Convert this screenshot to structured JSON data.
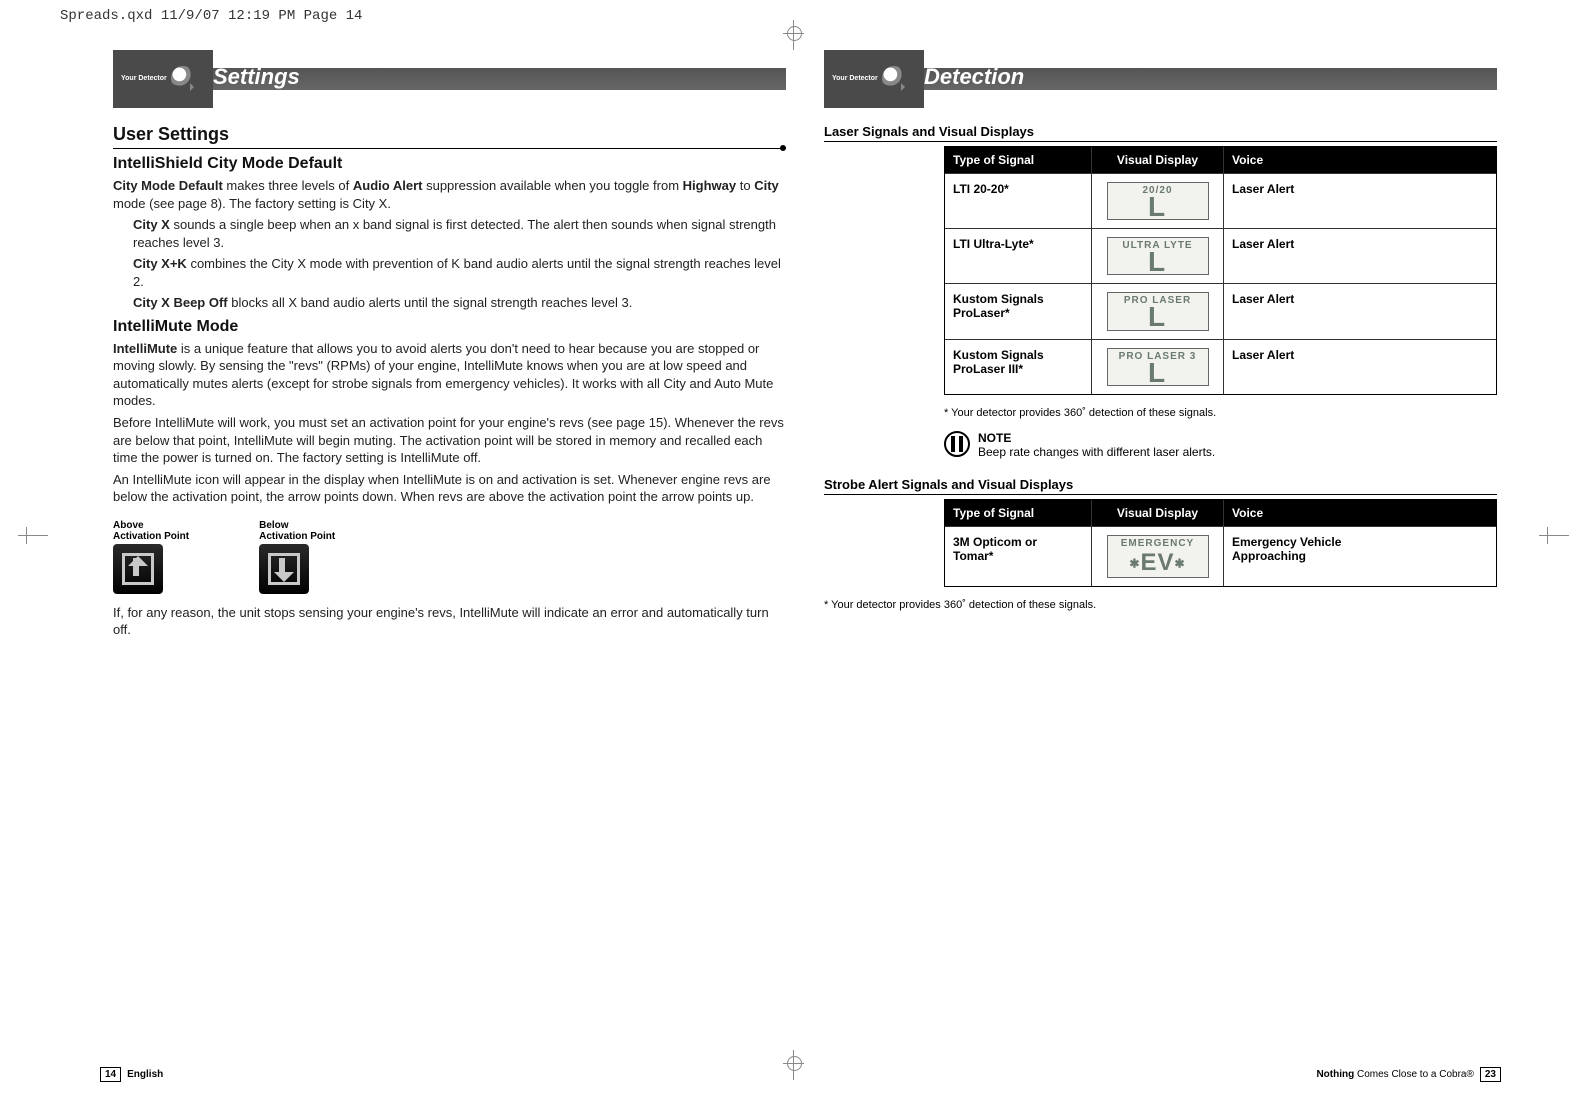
{
  "meta": {
    "imposition": "Spreads.qxd  11/9/07  12:19 PM  Page 14"
  },
  "left": {
    "banner": {
      "tag": "Your Detector",
      "title": "Settings"
    },
    "h2": "User Settings",
    "intellishield": {
      "title": "IntelliShield City Mode Default",
      "lead": "City Mode Default",
      "p1a": "makes three levels of",
      "bold1": "Audio Alert",
      "p1b": "suppression available when you toggle from",
      "bold2": "Highway",
      "p1c": "to",
      "bold3": "City",
      "p1d": "mode (see page 8). The factory setting is City X."
    },
    "modes": [
      {
        "name": "City X",
        "desc": "sounds a single beep when an x band signal is first detected. The alert then sounds when signal strength reaches level 3."
      },
      {
        "name": "City X+K",
        "desc": "combines the City X mode with prevention of K band audio alerts until the signal strength reaches level 2."
      },
      {
        "name": "City X Beep Off",
        "desc": "blocks all X band audio alerts until the signal strength reaches level 3."
      }
    ],
    "intellimute": {
      "title": "IntelliMute Mode",
      "lead": "IntelliMute",
      "p1": "is a unique feature that allows you to avoid alerts you don't need to hear because you are stopped or moving slowly. By sensing the \"revs\" (RPMs) of your engine, IntelliMute knows when you are at low speed and automatically mutes alerts (except for strobe signals from emergency vehicles). It works with all City and Auto Mute modes.",
      "p2": "Before IntelliMute will work, you must set an activation point for your engine's revs (see page 15). Whenever the revs are below that point, IntelliMute will begin muting. The activation point will be stored in memory and recalled each time the power is turned on. The factory setting is IntelliMute off.",
      "p3": "An IntelliMute icon will appear in the display when IntelliMute is on and activation is set. Whenever engine revs are below the activation point, the arrow points down. When revs are above the activation point the arrow points up.",
      "p4": "If, for any reason, the unit stops sensing your engine's revs, IntelliMute will indicate an error and automatically turn off."
    },
    "ap": {
      "above": {
        "l1": "Above",
        "l2": "Activation Point"
      },
      "below": {
        "l1": "Below",
        "l2": "Activation Point"
      }
    },
    "footer": {
      "page": "14",
      "lang": "English"
    }
  },
  "right": {
    "banner": {
      "tag": "Your Detector",
      "title": "Detection"
    },
    "headers": [
      "Type of Signal",
      "Visual Display",
      "Voice"
    ],
    "laser": {
      "caption": "Laser Signals and Visual Displays",
      "rows": [
        {
          "type": "LTI 20-20*",
          "lcd": "20/20",
          "glyph": "L",
          "voice": "Laser Alert"
        },
        {
          "type": "LTI Ultra-Lyte*",
          "lcd": "ULTRA LYTE",
          "glyph": "L",
          "voice": "Laser Alert"
        },
        {
          "type": "Kustom Signals",
          "type2": "ProLaser*",
          "lcd": "PRO LASER",
          "glyph": "L",
          "voice": "Laser Alert"
        },
        {
          "type": "Kustom Signals",
          "type2": "ProLaser III*",
          "lcd": "PRO LASER 3",
          "glyph": "L",
          "voice": "Laser Alert"
        }
      ]
    },
    "foot360": "* Your detector provides 360˚ detection of these signals.",
    "note": {
      "label": "NOTE",
      "text": "Beep rate changes with different laser alerts."
    },
    "strobe": {
      "caption": "Strobe Alert Signals and Visual Displays",
      "rows": [
        {
          "type": "3M Opticom or",
          "type2": "Tomar*",
          "lcd": "EMERGENCY",
          "glyph": "EV",
          "voice": "Emergency Vehicle",
          "voice2": "Approaching"
        }
      ]
    },
    "footer": {
      "b1": "Nothing",
      "t": "Comes Close to a Cobra®",
      "page": "23"
    }
  }
}
